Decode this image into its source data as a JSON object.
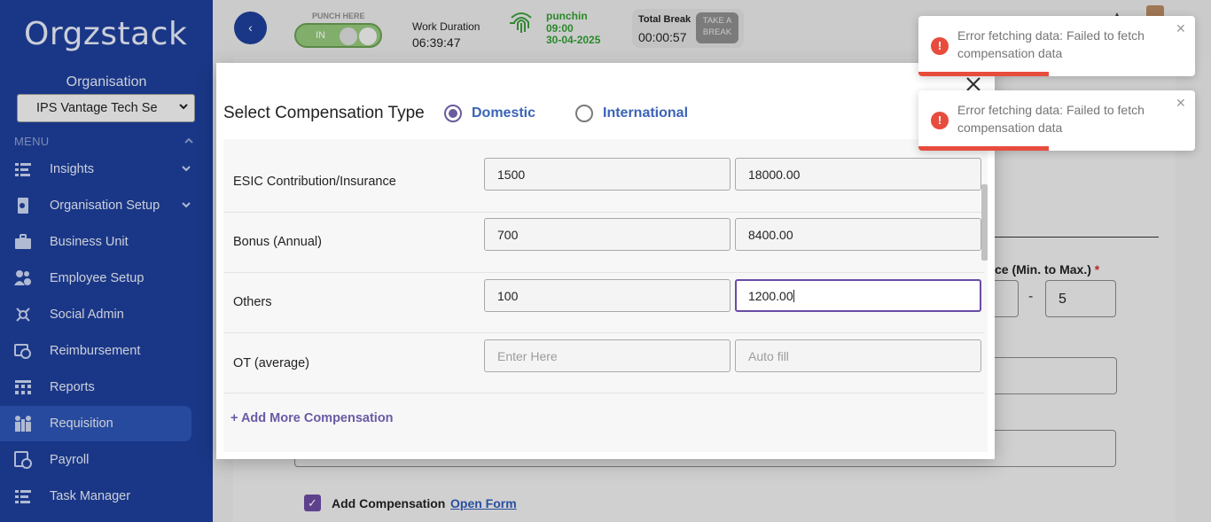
{
  "colors": {
    "sidebar_bg": "#1e3f9a",
    "accent_purple": "#6b4ba6",
    "link_blue": "#3b63b6",
    "error_red": "#e74c3c",
    "punch_green": "#2f9d2f"
  },
  "sidebar": {
    "logo": "Orgzstack",
    "org_label": "Organisation",
    "org_selected": "IPS Vantage Tech Se",
    "menu_label": "MENU",
    "items": [
      {
        "label": "Insights",
        "icon": "insights-icon",
        "has_chevron": true
      },
      {
        "label": "Organisation Setup",
        "icon": "organisation-setup-icon",
        "has_chevron": true
      },
      {
        "label": "Business Unit",
        "icon": "briefcase-icon",
        "has_chevron": false
      },
      {
        "label": "Employee Setup",
        "icon": "employee-icon",
        "has_chevron": false
      },
      {
        "label": "Social Admin",
        "icon": "social-admin-icon",
        "has_chevron": false
      },
      {
        "label": "Reimbursement",
        "icon": "reimbursement-icon",
        "has_chevron": false
      },
      {
        "label": "Reports",
        "icon": "reports-icon",
        "has_chevron": false
      },
      {
        "label": "Requisition",
        "icon": "requisition-icon",
        "has_chevron": false,
        "active": true
      },
      {
        "label": "Payroll",
        "icon": "payroll-icon",
        "has_chevron": false
      },
      {
        "label": "Task Manager",
        "icon": "task-manager-icon",
        "has_chevron": false
      }
    ]
  },
  "topbar": {
    "back_icon": "‹",
    "punch_label": "PUNCH HERE",
    "punch_state": "IN",
    "work_duration_label": "Work Duration",
    "work_duration_value": "06:39:47",
    "punchin_label": "punchin",
    "punchin_time": "09:00",
    "punchin_date": "30-04-2025",
    "total_break_label": "Total Break",
    "total_break_value": "00:00:57",
    "take_break_line1": "TAKE A",
    "take_break_line2": "BREAK"
  },
  "background": {
    "range_label": "ce (Min. to Max.)",
    "range_required": "*",
    "range_dash": "-",
    "range_max": "5",
    "add_compensation_label": "Add Compensation",
    "open_form_link": "Open Form",
    "checked": true
  },
  "modal": {
    "title": "Select Compensation Type",
    "options": [
      {
        "label": "Domestic",
        "selected": true
      },
      {
        "label": "International",
        "selected": false
      }
    ],
    "rows": [
      {
        "label": "ESIC Contribution/Insurance",
        "monthly": "1500",
        "annual": "18000.00",
        "monthly_placeholder": "",
        "annual_placeholder": ""
      },
      {
        "label": "Bonus (Annual)",
        "monthly": "700",
        "annual": "8400.00",
        "monthly_placeholder": "",
        "annual_placeholder": ""
      },
      {
        "label": "Others",
        "monthly": "100",
        "annual": "1200.00",
        "monthly_placeholder": "",
        "annual_placeholder": ""
      },
      {
        "label": "OT (average)",
        "monthly": "",
        "annual": "",
        "monthly_placeholder": "Enter Here",
        "annual_placeholder": "Auto fill"
      }
    ],
    "add_more": "+ Add More Compensation"
  },
  "toasts": [
    {
      "message": "Error fetching data: Failed to fetch compensation data",
      "progress": 0.47
    },
    {
      "message": "Error fetching data: Failed to fetch compensation data",
      "progress": 0.47
    }
  ]
}
